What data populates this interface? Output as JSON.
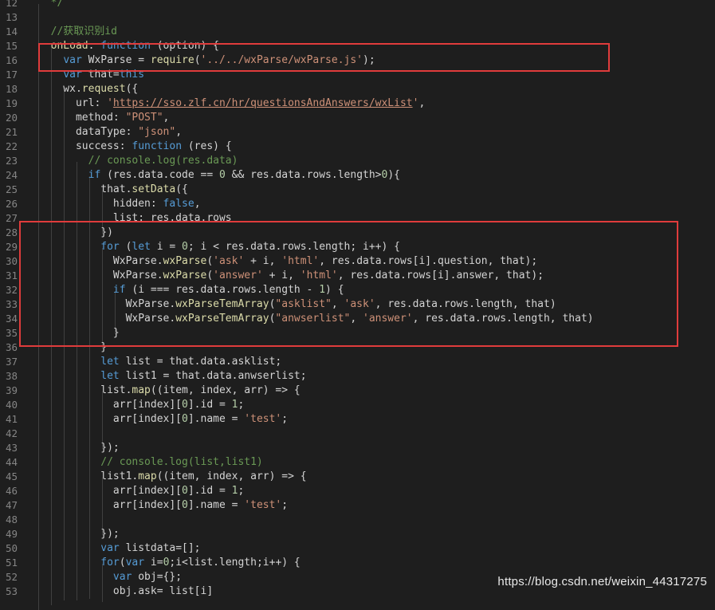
{
  "editor": {
    "lines": [
      {
        "n": "12",
        "tokens": [
          {
            "t": "  */",
            "c": "comment"
          }
        ]
      },
      {
        "n": "13",
        "tokens": []
      },
      {
        "n": "14",
        "tokens": [
          {
            "t": "  //获取识别id",
            "c": "comment"
          }
        ]
      },
      {
        "n": "15",
        "tokens": [
          {
            "t": "  onLoad",
            "c": "fn"
          },
          {
            "t": ": ",
            "c": "prop"
          },
          {
            "t": "function",
            "c": "kw"
          },
          {
            "t": " (option) {",
            "c": "prop"
          }
        ]
      },
      {
        "n": "16",
        "tokens": [
          {
            "t": "    ",
            "c": "prop"
          },
          {
            "t": "var",
            "c": "kw"
          },
          {
            "t": " WxParse = ",
            "c": "var"
          },
          {
            "t": "require",
            "c": "fn"
          },
          {
            "t": "(",
            "c": "prop"
          },
          {
            "t": "'../../wxParse/wxParse.js'",
            "c": "str"
          },
          {
            "t": ");",
            "c": "prop"
          }
        ]
      },
      {
        "n": "17",
        "tokens": [
          {
            "t": "    ",
            "c": "prop"
          },
          {
            "t": "var",
            "c": "kw"
          },
          {
            "t": " that=",
            "c": "var"
          },
          {
            "t": "this",
            "c": "kw"
          }
        ]
      },
      {
        "n": "18",
        "tokens": [
          {
            "t": "    wx.",
            "c": "var"
          },
          {
            "t": "request",
            "c": "fn"
          },
          {
            "t": "({",
            "c": "prop"
          }
        ]
      },
      {
        "n": "19",
        "tokens": [
          {
            "t": "      url: ",
            "c": "prop"
          },
          {
            "t": "'",
            "c": "str"
          },
          {
            "t": "https://sso.zlf.cn/hr/questionsAndAnswers/wxList",
            "c": "url"
          },
          {
            "t": "'",
            "c": "str"
          },
          {
            "t": ",",
            "c": "prop"
          }
        ]
      },
      {
        "n": "20",
        "tokens": [
          {
            "t": "      method: ",
            "c": "prop"
          },
          {
            "t": "\"POST\"",
            "c": "str"
          },
          {
            "t": ",",
            "c": "prop"
          }
        ]
      },
      {
        "n": "21",
        "tokens": [
          {
            "t": "      dataType: ",
            "c": "prop"
          },
          {
            "t": "\"json\"",
            "c": "str"
          },
          {
            "t": ",",
            "c": "prop"
          }
        ]
      },
      {
        "n": "22",
        "tokens": [
          {
            "t": "      success: ",
            "c": "prop"
          },
          {
            "t": "function",
            "c": "kw"
          },
          {
            "t": " (res) {",
            "c": "prop"
          }
        ]
      },
      {
        "n": "23",
        "tokens": [
          {
            "t": "        // console.log(res.data)",
            "c": "comment"
          }
        ]
      },
      {
        "n": "24",
        "tokens": [
          {
            "t": "        ",
            "c": "prop"
          },
          {
            "t": "if",
            "c": "kw"
          },
          {
            "t": " (res.data.code == ",
            "c": "prop"
          },
          {
            "t": "0",
            "c": "num"
          },
          {
            "t": " && res.data.rows.length>",
            "c": "prop"
          },
          {
            "t": "0",
            "c": "num"
          },
          {
            "t": "){",
            "c": "prop"
          }
        ]
      },
      {
        "n": "25",
        "tokens": [
          {
            "t": "          that.",
            "c": "prop"
          },
          {
            "t": "setData",
            "c": "fn"
          },
          {
            "t": "({",
            "c": "prop"
          }
        ]
      },
      {
        "n": "26",
        "tokens": [
          {
            "t": "            hidden: ",
            "c": "prop"
          },
          {
            "t": "false",
            "c": "kw"
          },
          {
            "t": ",",
            "c": "prop"
          }
        ]
      },
      {
        "n": "27",
        "tokens": [
          {
            "t": "            list: res.data.rows",
            "c": "prop"
          }
        ]
      },
      {
        "n": "28",
        "tokens": [
          {
            "t": "          })",
            "c": "prop"
          }
        ]
      },
      {
        "n": "29",
        "tokens": [
          {
            "t": "          ",
            "c": "prop"
          },
          {
            "t": "for",
            "c": "kw"
          },
          {
            "t": " (",
            "c": "prop"
          },
          {
            "t": "let",
            "c": "kw"
          },
          {
            "t": " i = ",
            "c": "prop"
          },
          {
            "t": "0",
            "c": "num"
          },
          {
            "t": "; i < res.data.rows.length; i++) {",
            "c": "prop"
          }
        ]
      },
      {
        "n": "30",
        "tokens": [
          {
            "t": "            WxParse.",
            "c": "var"
          },
          {
            "t": "wxParse",
            "c": "fn"
          },
          {
            "t": "(",
            "c": "prop"
          },
          {
            "t": "'ask'",
            "c": "str"
          },
          {
            "t": " + i, ",
            "c": "prop"
          },
          {
            "t": "'html'",
            "c": "str"
          },
          {
            "t": ", res.data.rows[i].question, that);",
            "c": "prop"
          }
        ]
      },
      {
        "n": "31",
        "tokens": [
          {
            "t": "            WxParse.",
            "c": "var"
          },
          {
            "t": "wxParse",
            "c": "fn"
          },
          {
            "t": "(",
            "c": "prop"
          },
          {
            "t": "'answer'",
            "c": "str"
          },
          {
            "t": " + i, ",
            "c": "prop"
          },
          {
            "t": "'html'",
            "c": "str"
          },
          {
            "t": ", res.data.rows[i].answer, that);",
            "c": "prop"
          }
        ]
      },
      {
        "n": "32",
        "tokens": [
          {
            "t": "            ",
            "c": "prop"
          },
          {
            "t": "if",
            "c": "kw"
          },
          {
            "t": " (i === res.data.rows.length - ",
            "c": "prop"
          },
          {
            "t": "1",
            "c": "num"
          },
          {
            "t": ") {",
            "c": "prop"
          }
        ]
      },
      {
        "n": "33",
        "tokens": [
          {
            "t": "              WxParse.",
            "c": "var"
          },
          {
            "t": "wxParseTemArray",
            "c": "fn"
          },
          {
            "t": "(",
            "c": "prop"
          },
          {
            "t": "\"asklist\"",
            "c": "str"
          },
          {
            "t": ", ",
            "c": "prop"
          },
          {
            "t": "'ask'",
            "c": "str"
          },
          {
            "t": ", res.data.rows.length, that)",
            "c": "prop"
          }
        ]
      },
      {
        "n": "34",
        "tokens": [
          {
            "t": "              WxParse.",
            "c": "var"
          },
          {
            "t": "wxParseTemArray",
            "c": "fn"
          },
          {
            "t": "(",
            "c": "prop"
          },
          {
            "t": "\"anwserlist\"",
            "c": "str"
          },
          {
            "t": ", ",
            "c": "prop"
          },
          {
            "t": "'answer'",
            "c": "str"
          },
          {
            "t": ", res.data.rows.length, that)",
            "c": "prop"
          }
        ]
      },
      {
        "n": "35",
        "tokens": [
          {
            "t": "            }",
            "c": "prop"
          }
        ]
      },
      {
        "n": "36",
        "tokens": [
          {
            "t": "          }",
            "c": "prop"
          }
        ]
      },
      {
        "n": "37",
        "tokens": [
          {
            "t": "          ",
            "c": "prop"
          },
          {
            "t": "let",
            "c": "kw"
          },
          {
            "t": " list = that.data.asklist;",
            "c": "prop"
          }
        ]
      },
      {
        "n": "38",
        "tokens": [
          {
            "t": "          ",
            "c": "prop"
          },
          {
            "t": "let",
            "c": "kw"
          },
          {
            "t": " list1 = that.data.anwserlist;",
            "c": "prop"
          }
        ]
      },
      {
        "n": "39",
        "tokens": [
          {
            "t": "          list.",
            "c": "prop"
          },
          {
            "t": "map",
            "c": "fn"
          },
          {
            "t": "((item, index, arr) => {",
            "c": "prop"
          }
        ]
      },
      {
        "n": "40",
        "tokens": [
          {
            "t": "            arr[index][",
            "c": "prop"
          },
          {
            "t": "0",
            "c": "num"
          },
          {
            "t": "].id = ",
            "c": "prop"
          },
          {
            "t": "1",
            "c": "num"
          },
          {
            "t": ";",
            "c": "prop"
          }
        ]
      },
      {
        "n": "41",
        "tokens": [
          {
            "t": "            arr[index][",
            "c": "prop"
          },
          {
            "t": "0",
            "c": "num"
          },
          {
            "t": "].name = ",
            "c": "prop"
          },
          {
            "t": "'test'",
            "c": "str"
          },
          {
            "t": ";",
            "c": "prop"
          }
        ]
      },
      {
        "n": "42",
        "tokens": []
      },
      {
        "n": "43",
        "tokens": [
          {
            "t": "          });",
            "c": "prop"
          }
        ]
      },
      {
        "n": "44",
        "tokens": [
          {
            "t": "          // console.log(list,list1)",
            "c": "comment"
          }
        ]
      },
      {
        "n": "45",
        "tokens": [
          {
            "t": "          list1.",
            "c": "prop"
          },
          {
            "t": "map",
            "c": "fn"
          },
          {
            "t": "((item, index, arr) => {",
            "c": "prop"
          }
        ]
      },
      {
        "n": "46",
        "tokens": [
          {
            "t": "            arr[index][",
            "c": "prop"
          },
          {
            "t": "0",
            "c": "num"
          },
          {
            "t": "].id = ",
            "c": "prop"
          },
          {
            "t": "1",
            "c": "num"
          },
          {
            "t": ";",
            "c": "prop"
          }
        ]
      },
      {
        "n": "47",
        "tokens": [
          {
            "t": "            arr[index][",
            "c": "prop"
          },
          {
            "t": "0",
            "c": "num"
          },
          {
            "t": "].name = ",
            "c": "prop"
          },
          {
            "t": "'test'",
            "c": "str"
          },
          {
            "t": ";",
            "c": "prop"
          }
        ]
      },
      {
        "n": "48",
        "tokens": []
      },
      {
        "n": "49",
        "tokens": [
          {
            "t": "          });",
            "c": "prop"
          }
        ]
      },
      {
        "n": "50",
        "tokens": [
          {
            "t": "          ",
            "c": "prop"
          },
          {
            "t": "var",
            "c": "kw"
          },
          {
            "t": " listdata=[];",
            "c": "prop"
          }
        ]
      },
      {
        "n": "51",
        "tokens": [
          {
            "t": "          ",
            "c": "prop"
          },
          {
            "t": "for",
            "c": "kw"
          },
          {
            "t": "(",
            "c": "prop"
          },
          {
            "t": "var",
            "c": "kw"
          },
          {
            "t": " i=",
            "c": "prop"
          },
          {
            "t": "0",
            "c": "num"
          },
          {
            "t": ";i<list.length;i++) {",
            "c": "prop"
          }
        ]
      },
      {
        "n": "52",
        "tokens": [
          {
            "t": "            ",
            "c": "prop"
          },
          {
            "t": "var",
            "c": "kw"
          },
          {
            "t": " obj={};",
            "c": "prop"
          }
        ]
      },
      {
        "n": "53",
        "tokens": [
          {
            "t": "            obj.ask= list[i]",
            "c": "prop"
          }
        ]
      }
    ]
  },
  "colors": {
    "background": "#1e1e1e",
    "highlight_box": "#e03c3c"
  },
  "watermark": "https://blog.csdn.net/weixin_44317275"
}
